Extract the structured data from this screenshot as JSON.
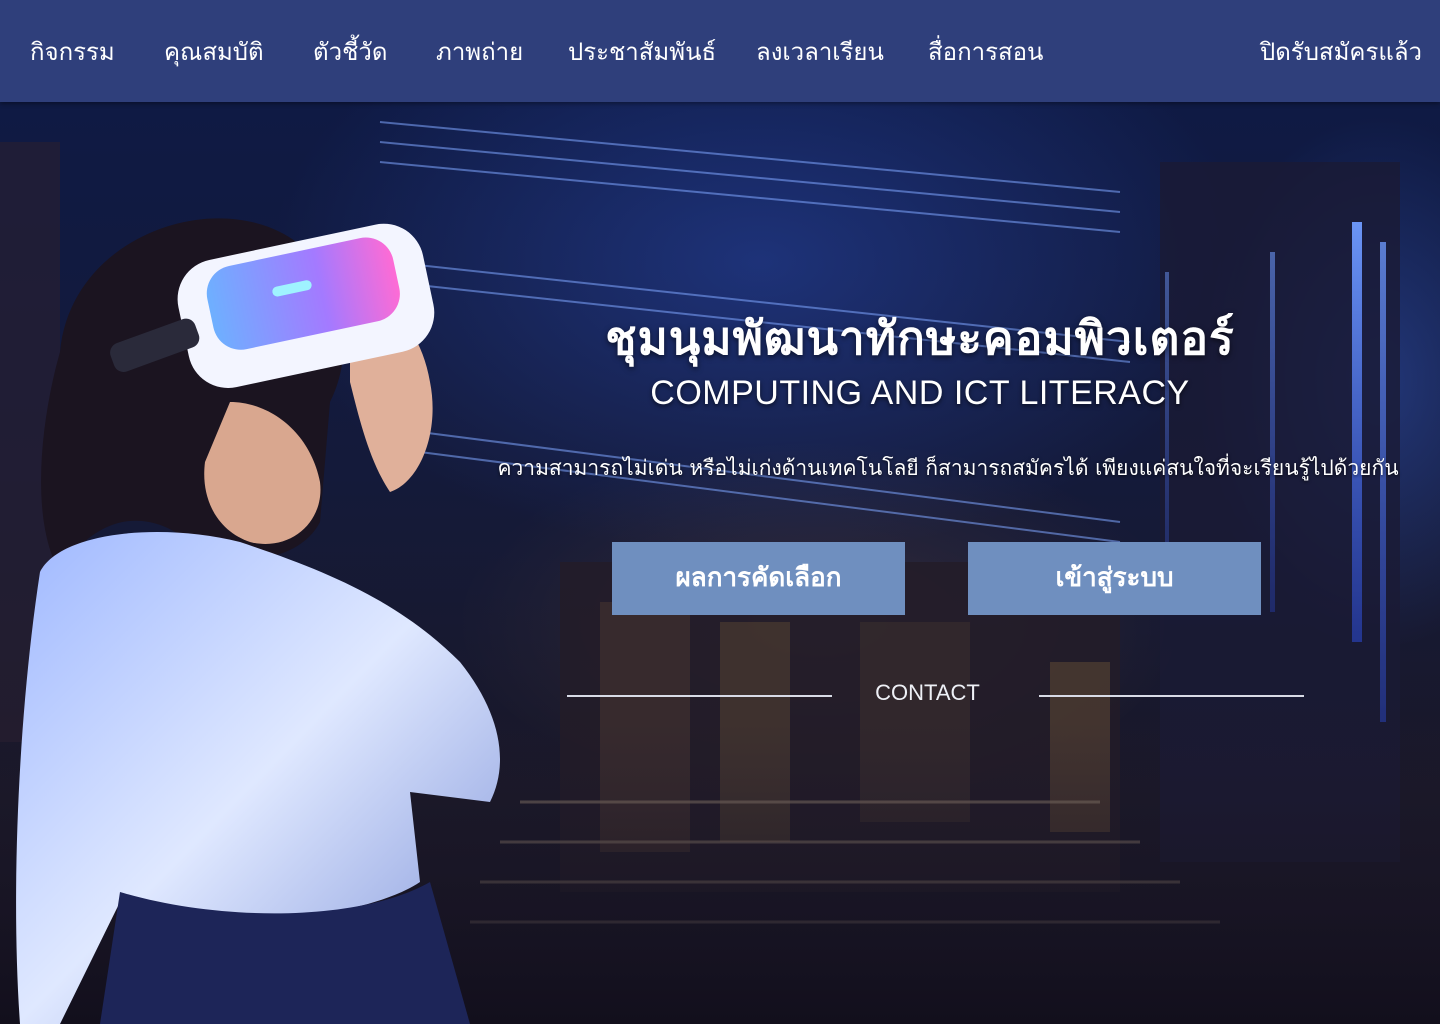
{
  "nav": {
    "items": [
      "กิจกรรม",
      "คุณสมบัติ",
      "ตัวชี้วัด",
      "ภาพถ่าย",
      "ประชาสัมพันธ์",
      "ลงเวลาเรียน",
      "สื่อการสอน"
    ],
    "status": "ปิดรับสมัครแล้ว"
  },
  "hero": {
    "title": "ชุมนุมพัฒนาทักษะคอมพิวเตอร์",
    "subtitle": "COMPUTING AND ICT LITERACY",
    "tagline": "ความสามารถไม่เด่น  หรือไม่เก่งด้านเทคโนโลยี  ก็สามารถสมัครได้  เพียงแค่สนใจที่จะเรียนรู้ไปด้วยกัน",
    "buttons": {
      "results": "ผลการคัดเลือก",
      "login": "เข้าสู่ระบบ"
    },
    "contact": "CONTACT"
  },
  "colors": {
    "navbar": "#2f3f7b",
    "button": "#6f8fbf",
    "neon_accent": "#4f7dff"
  }
}
